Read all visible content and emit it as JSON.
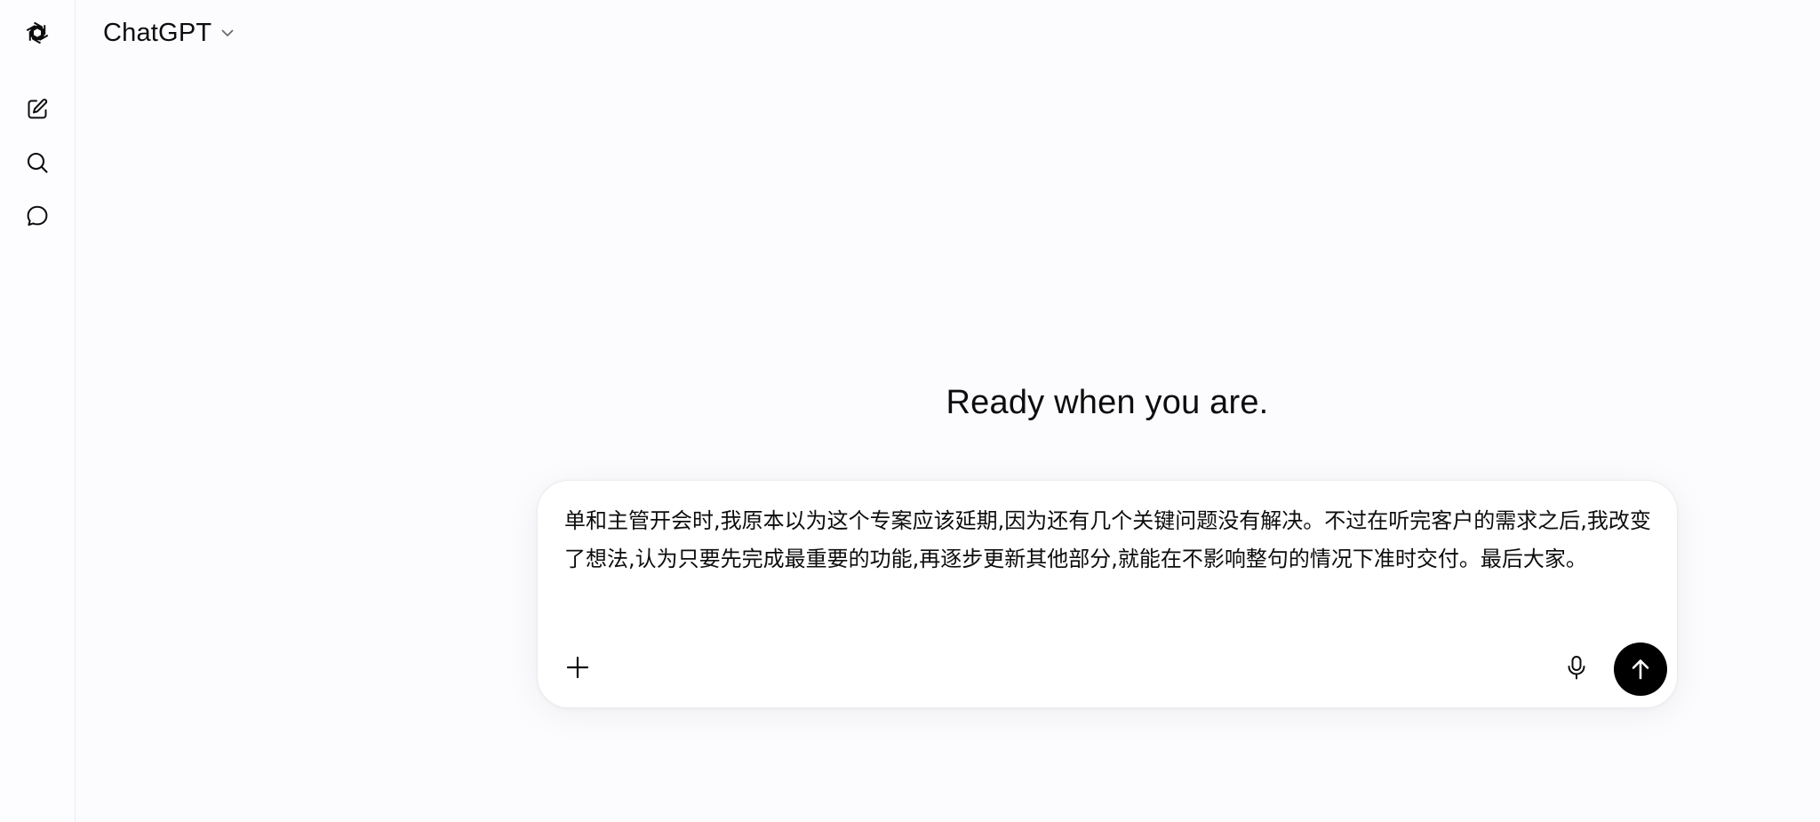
{
  "header": {
    "model_name": "ChatGPT"
  },
  "sidebar": {
    "items": [
      {
        "name": "new-chat",
        "icon": "pencil-square-icon"
      },
      {
        "name": "search",
        "icon": "search-icon"
      },
      {
        "name": "chats",
        "icon": "chat-bubble-icon"
      }
    ]
  },
  "main": {
    "headline": "Ready when you are.",
    "composer": {
      "text": "单和主管开会时,我原本以为这个专案应该延期,因为还有几个关键问题没有解决。不过在听完客户的需求之后,我改变了想法,认为只要先完成最重要的功能,再逐步更新其他部分,就能在不影响整句的情况下准时交付。最后大家。"
    }
  },
  "colors": {
    "background": "#fcfbfe",
    "send_button": "#000000",
    "text": "#0d0d0d"
  }
}
